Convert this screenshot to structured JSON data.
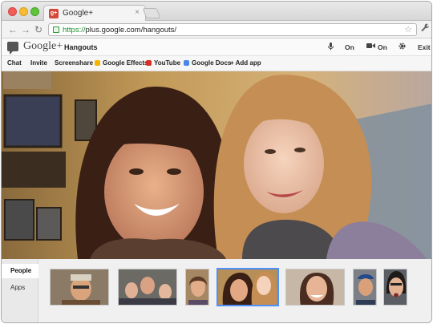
{
  "browser": {
    "tab_title": "Google+",
    "tab_favicon": "g+",
    "tab_close": "×",
    "url_scheme": "https://",
    "url_rest": "plus.google.com/hangouts/",
    "nav": {
      "back": "←",
      "forward": "→",
      "reload": "↻"
    },
    "star": "☆",
    "wrench": "🔧"
  },
  "header": {
    "brand": "Google+",
    "page_name": "Hangouts",
    "mic_state": "On",
    "camera_state": "On",
    "exit_label": "Exit"
  },
  "toolbar": {
    "items": [
      {
        "label": "Chat"
      },
      {
        "label": "Invite"
      },
      {
        "label": "Screenshare"
      },
      {
        "label": "Google Effects"
      },
      {
        "label": "YouTube"
      },
      {
        "label": "Google Docs"
      },
      {
        "label": "+ Add app"
      }
    ]
  },
  "sidebar": {
    "tabs": [
      {
        "label": "People"
      },
      {
        "label": "Apps"
      }
    ]
  },
  "colors": {
    "accent": "#4d90fe",
    "url_secure": "#1c8f2c",
    "googleplus_red": "#d34836"
  }
}
